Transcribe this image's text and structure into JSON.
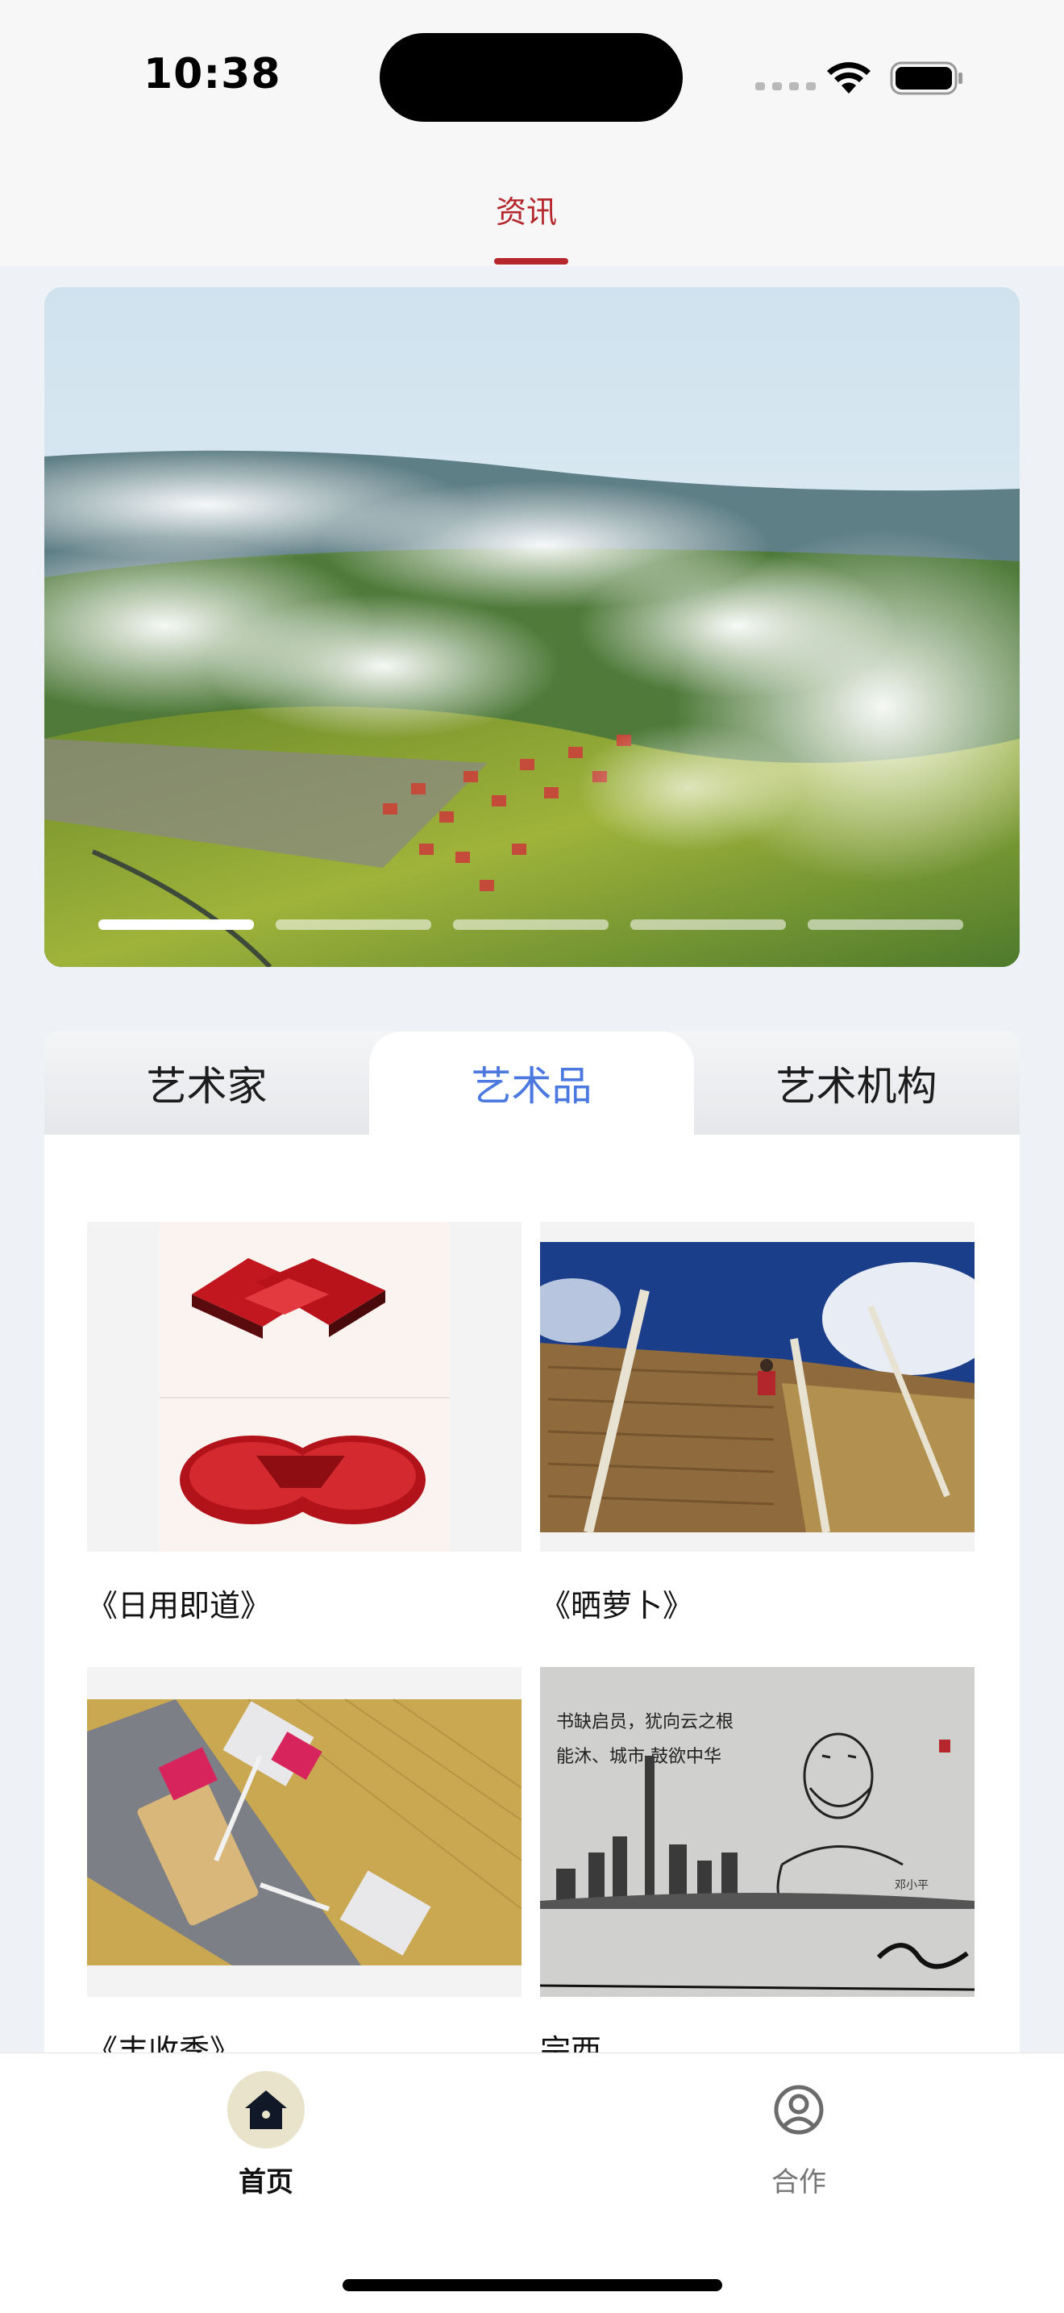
{
  "status_bar": {
    "time": "10:38"
  },
  "header": {
    "tab_label": "资讯"
  },
  "banner": {
    "slide_count": 5,
    "active_slide": 1
  },
  "category_tabs": [
    {
      "label": "艺术家",
      "active": false
    },
    {
      "label": "艺术品",
      "active": true
    },
    {
      "label": "艺术机构",
      "active": false
    }
  ],
  "artworks": [
    {
      "title": "《日用即道》"
    },
    {
      "title": "《晒萝卜》"
    },
    {
      "title": "《丰收季》"
    },
    {
      "title": "宗西"
    }
  ],
  "calligraphy": {
    "line1": "书缺启员，犹向云之根",
    "line2": "能沐、城市 鼓欲中华",
    "signature": "邓小平"
  },
  "bottom_nav": [
    {
      "label": "首页",
      "icon": "home-icon",
      "active": true
    },
    {
      "label": "合作",
      "icon": "user-circle-icon",
      "active": false
    }
  ],
  "colors": {
    "accent_red": "#b5262d",
    "active_tab_blue": "#4b79e0",
    "page_bg": "#eef2f7",
    "home_icon_bg": "#e9e3cc"
  }
}
